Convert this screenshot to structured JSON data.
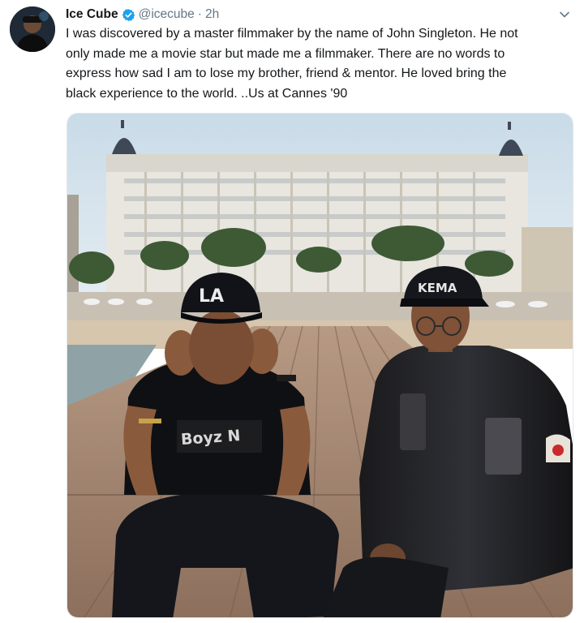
{
  "tweet": {
    "author_name": "Ice Cube",
    "handle": "@icecube",
    "separator": "·",
    "time": "2h",
    "verified_icon": "verified-badge-icon",
    "menu_icon": "chevron-down-icon",
    "text": "I was discovered by a master filmmaker by the name of John Singleton. He not\nonly made me a movie star but made me a filmmaker.  There are no words to\nexpress how sad I am to lose my brother, friend & mentor.  He loved bring the\nblack experience to the world. ..Us at Cannes '90"
  },
  "photo": {
    "cap_left_logo": "LA",
    "cap_right_text": "KEMA"
  },
  "colors": {
    "verified_blue": "#1da1f2",
    "text_primary": "#14171a",
    "text_secondary": "#657786"
  }
}
